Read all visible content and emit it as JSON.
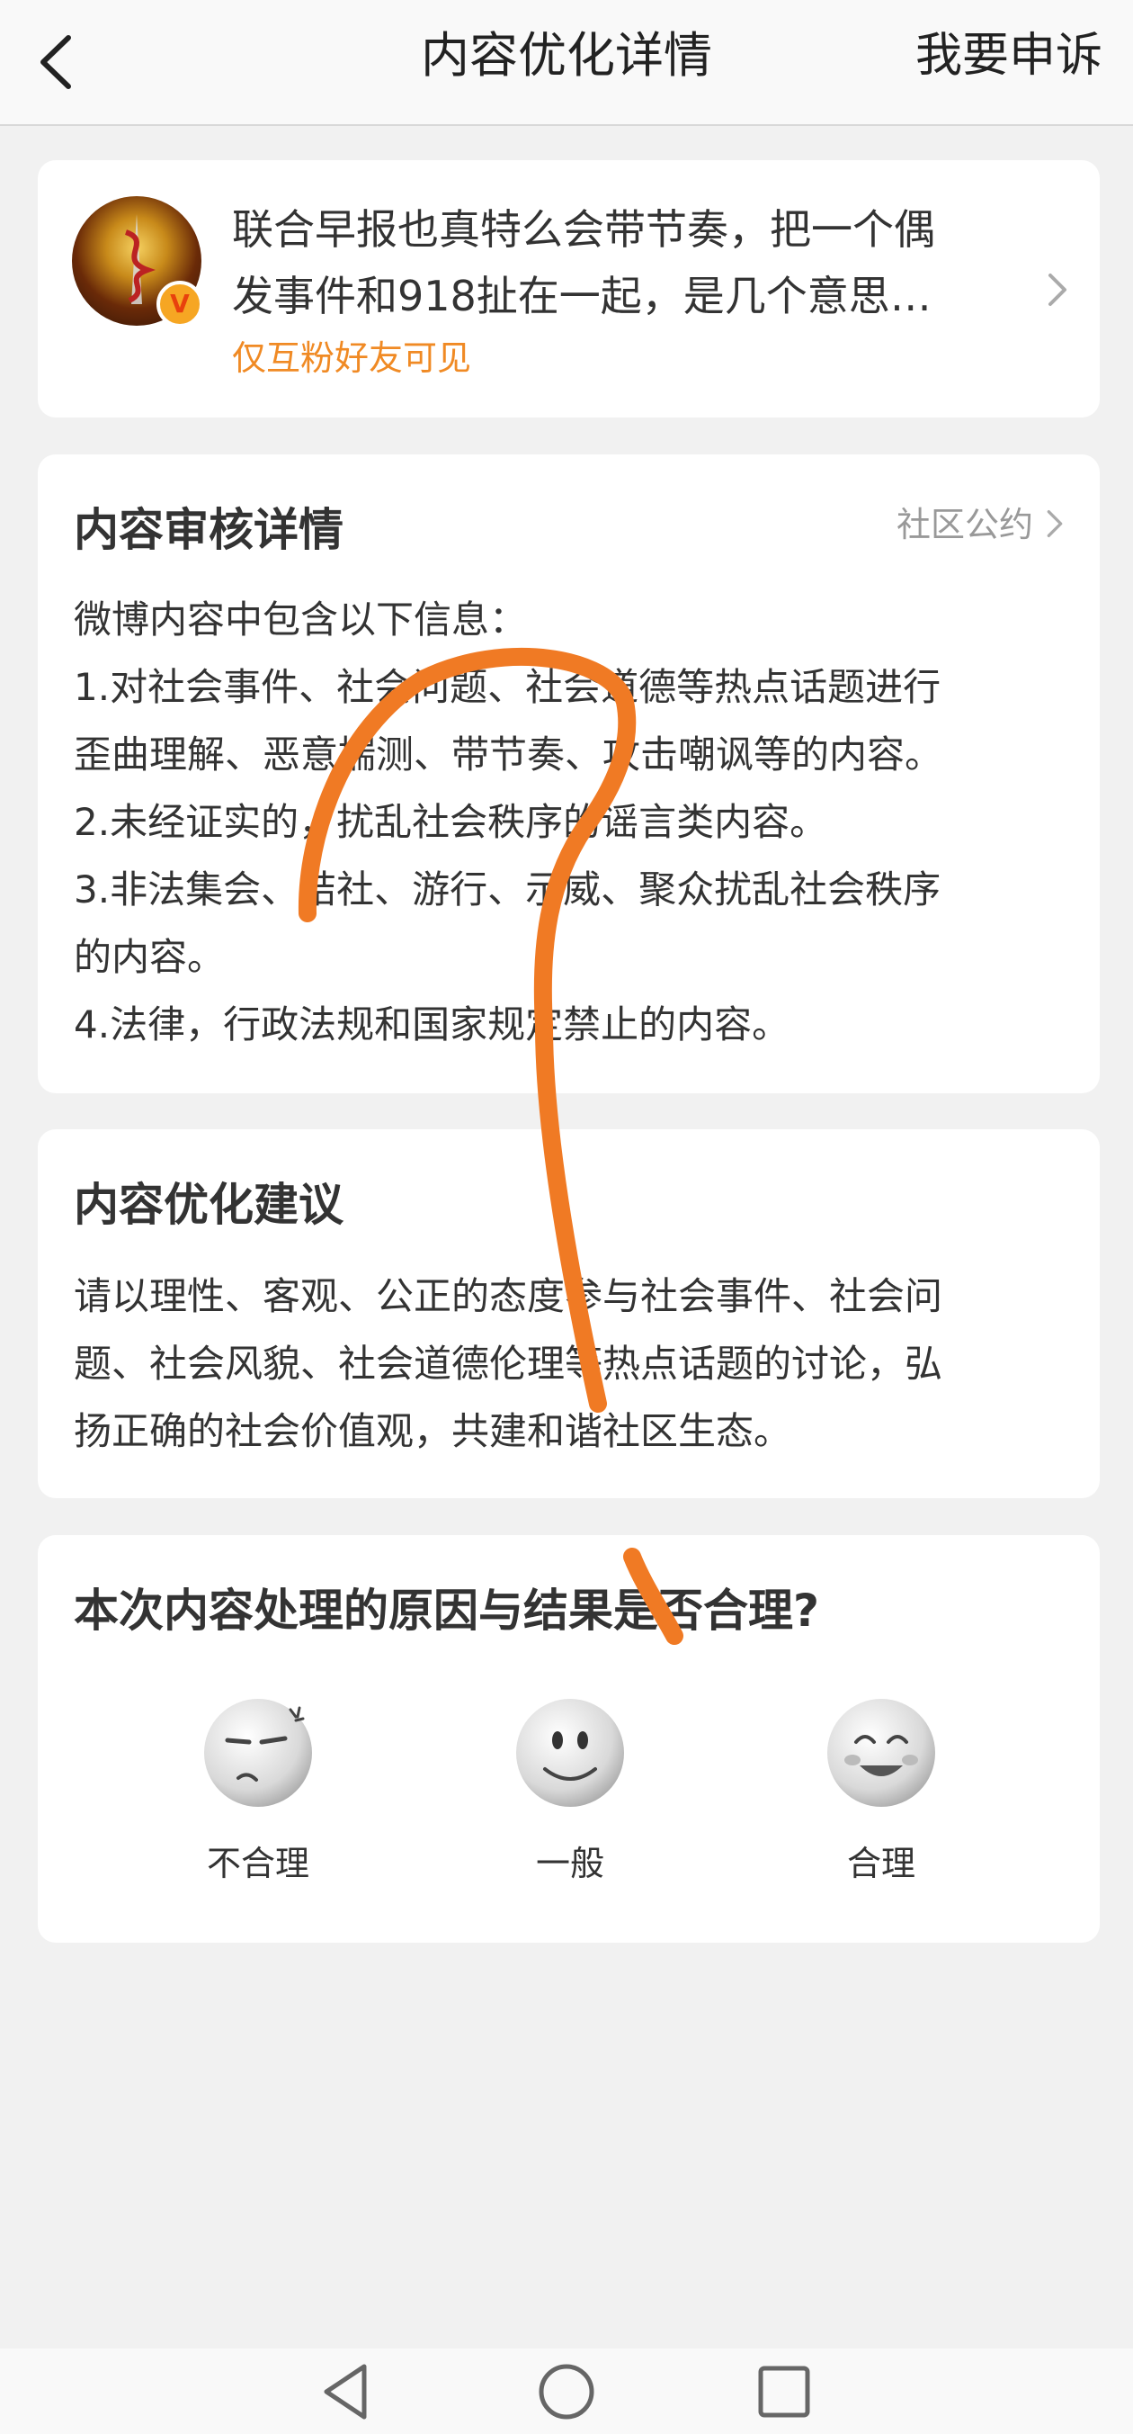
{
  "header": {
    "title": "内容优化详情",
    "appeal_label": "我要申诉"
  },
  "post": {
    "text_lines": [
      "联合早报也真特么会带节奏，把一个偶",
      "发事件和918扯在一起，是几个意思…"
    ],
    "visibility": "仅互粉好友可见",
    "badge": "V"
  },
  "review": {
    "title": "内容审核详情",
    "community_link": "社区公约",
    "lines": [
      "微博内容中包含以下信息：",
      "1.对社会事件、社会问题、社会道德等热点话题进行",
      "歪曲理解、恶意揣测、带节奏、攻击嘲讽等的内容。",
      "2.未经证实的，扰乱社会秩序的谣言类内容。",
      "3.非法集会、结社、游行、示威、聚众扰乱社会秩序",
      "的内容。",
      "4.法律，行政法规和国家规定禁止的内容。"
    ]
  },
  "suggestion": {
    "title": "内容优化建议",
    "lines": [
      "请以理性、客观、公正的态度参与社会事件、社会问",
      "题、社会风貌、社会道德伦理等热点话题的讨论，弘",
      "扬正确的社会价值观，共建和谐社区生态。"
    ]
  },
  "feedback": {
    "title": "本次内容处理的原因与结果是否合理?",
    "options": [
      {
        "label": "不合理",
        "icon": "angry-face-icon"
      },
      {
        "label": "一般",
        "icon": "neutral-face-icon"
      },
      {
        "label": "合理",
        "icon": "happy-face-icon"
      }
    ]
  },
  "colors": {
    "accent_orange": "#f08a24",
    "scribble": "#f07a24",
    "background": "#f1f1f1"
  }
}
